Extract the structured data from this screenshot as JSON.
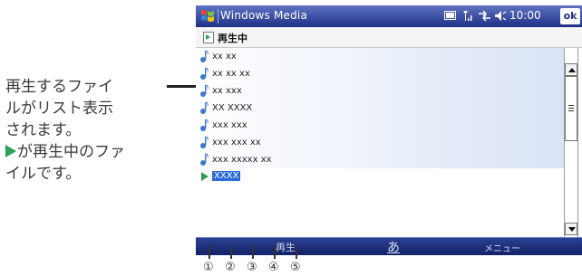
{
  "annotation": {
    "lines": [
      "再生するファイ",
      "ルがリスト表示",
      "されます。",
      "が再生中のファ",
      "イルです。"
    ]
  },
  "titlebar": {
    "app_title": "Windows Media",
    "clock": "10:00",
    "ok_label": "ok"
  },
  "list_header": {
    "label": "再生中"
  },
  "playlist": {
    "items": [
      "xx xx",
      "xx xx xx",
      "xx xxx",
      "XX XXXX",
      "xxx xxx",
      "xxx xxx xx",
      "xxx xxxxx xx"
    ],
    "now_playing": "XXXX"
  },
  "softkeys": {
    "left": "再生",
    "input": "あ",
    "right": "メニュー"
  },
  "tool_numbers": [
    "①",
    "②",
    "③",
    "④",
    "⑤"
  ],
  "colors": {
    "title_bar": "#1d2f86",
    "play_indicator": "#2e9e5b",
    "selection": "#2b6ad9"
  }
}
